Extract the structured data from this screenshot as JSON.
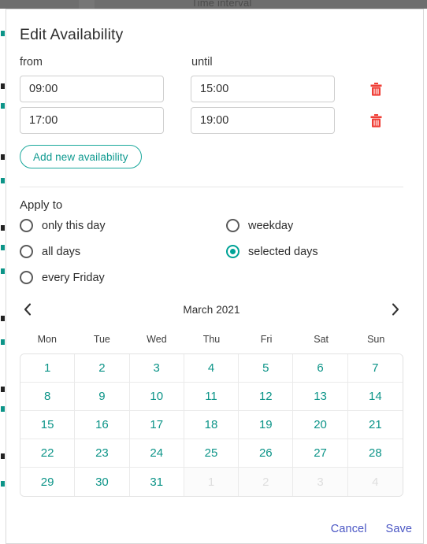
{
  "backdrop": {
    "obscured_title": "Time interval"
  },
  "dialog": {
    "title": "Edit Availability",
    "column_from_label": "from",
    "column_until_label": "until",
    "availability_rows": [
      {
        "from": "09:00",
        "until": "15:00",
        "delete_icon": "trash-icon"
      },
      {
        "from": "17:00",
        "until": "19:00",
        "delete_icon": "trash-icon"
      }
    ],
    "add_button_label": "Add new availability",
    "apply_to_label": "Apply to",
    "apply_to_options": [
      {
        "label": "only this day",
        "selected": false
      },
      {
        "label": "weekday",
        "selected": false
      },
      {
        "label": "all days",
        "selected": false
      },
      {
        "label": "selected days",
        "selected": true
      },
      {
        "label": "every Friday",
        "selected": false
      }
    ],
    "footer": {
      "cancel_label": "Cancel",
      "save_label": "Save"
    }
  },
  "calendar": {
    "month_label": "March 2021",
    "prev_icon": "chevron-left-icon",
    "next_icon": "chevron-right-icon",
    "weekdays": [
      "Mon",
      "Tue",
      "Wed",
      "Thu",
      "Fri",
      "Sat",
      "Sun"
    ],
    "days": [
      {
        "n": "1",
        "muted": false
      },
      {
        "n": "2",
        "muted": false
      },
      {
        "n": "3",
        "muted": false
      },
      {
        "n": "4",
        "muted": false
      },
      {
        "n": "5",
        "muted": false
      },
      {
        "n": "6",
        "muted": false
      },
      {
        "n": "7",
        "muted": false
      },
      {
        "n": "8",
        "muted": false
      },
      {
        "n": "9",
        "muted": false
      },
      {
        "n": "10",
        "muted": false
      },
      {
        "n": "11",
        "muted": false
      },
      {
        "n": "12",
        "muted": false
      },
      {
        "n": "13",
        "muted": false
      },
      {
        "n": "14",
        "muted": false
      },
      {
        "n": "15",
        "muted": false
      },
      {
        "n": "16",
        "muted": false
      },
      {
        "n": "17",
        "muted": false
      },
      {
        "n": "18",
        "muted": false
      },
      {
        "n": "19",
        "muted": false
      },
      {
        "n": "20",
        "muted": false
      },
      {
        "n": "21",
        "muted": false
      },
      {
        "n": "22",
        "muted": false
      },
      {
        "n": "23",
        "muted": false
      },
      {
        "n": "24",
        "muted": false
      },
      {
        "n": "25",
        "muted": false
      },
      {
        "n": "26",
        "muted": false
      },
      {
        "n": "27",
        "muted": false
      },
      {
        "n": "28",
        "muted": false
      },
      {
        "n": "29",
        "muted": false
      },
      {
        "n": "30",
        "muted": false
      },
      {
        "n": "31",
        "muted": false
      },
      {
        "n": "1",
        "muted": true
      },
      {
        "n": "2",
        "muted": true
      },
      {
        "n": "3",
        "muted": true
      },
      {
        "n": "4",
        "muted": true
      }
    ]
  },
  "colors": {
    "teal": "#0c9488",
    "teal_accent": "#00a397",
    "danger_red": "#ef3e36",
    "action_blue": "#4a56c4",
    "border_gray": "#e2e2e2"
  }
}
